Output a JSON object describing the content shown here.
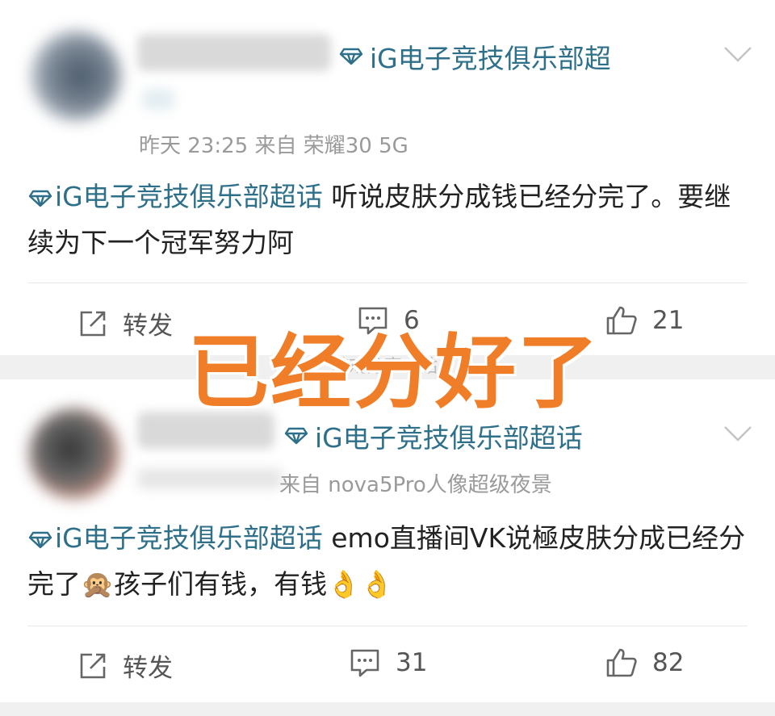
{
  "post1": {
    "topic_header": "iG电子竞技俱乐部超",
    "meta": "昨天 23:25  来自 荣耀30 5G",
    "body_topic": "iG电子竞技俱乐部超话",
    "body_text": " 听说皮肤分成钱已经分完了。要继续为下一个冠军努力阿",
    "actions": {
      "repost": "转发",
      "comments": "6",
      "likes": "21"
    }
  },
  "post2": {
    "topic_header": "iG电子竞技俱乐部超话",
    "meta": "来自 nova5Pro人像超级夜景",
    "body_topic": "iG电子竞技俱乐部超话",
    "body_text_1": " emo直播间VK说極皮肤分成已经分完了",
    "body_emoji_1": "🙊",
    "body_text_2": "孩子们有钱，有钱",
    "body_emoji_2": "👌👌",
    "actions": {
      "repost": "转发",
      "comments": "31",
      "likes": "82"
    }
  },
  "overlay_text": "已经分好了",
  "watermark": "游戏分享小站",
  "colors": {
    "topic": "#2e6f8a",
    "overlay": "#f07d28",
    "meta": "#9a9a9a"
  }
}
